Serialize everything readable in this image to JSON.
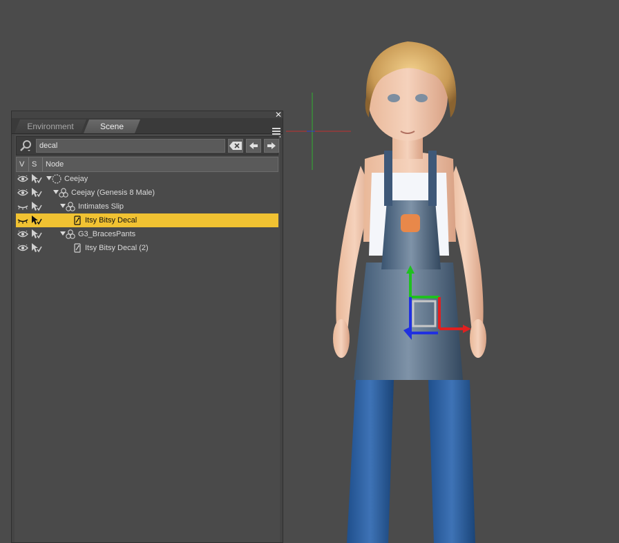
{
  "pane": {
    "tabs": [
      {
        "label": "Environment",
        "active": false
      },
      {
        "label": "Scene",
        "active": true
      }
    ]
  },
  "search": {
    "value": "decal",
    "placeholder": ""
  },
  "tree": {
    "columns": [
      "V",
      "S",
      "Node"
    ],
    "rows": [
      {
        "label": "Ceejay",
        "icon": "group-node-icon",
        "depth": 0,
        "expandable": true,
        "selected": false,
        "visible": true
      },
      {
        "label": "Ceejay (Genesis 8 Male)",
        "icon": "figure-icon",
        "depth": 1,
        "expandable": true,
        "selected": false,
        "visible": true
      },
      {
        "label": "Intimates Slip",
        "icon": "figure-icon",
        "depth": 2,
        "expandable": true,
        "selected": false,
        "visible": false
      },
      {
        "label": "Itsy Bitsy Decal",
        "icon": "decal-icon",
        "depth": 3,
        "expandable": false,
        "selected": true,
        "visible": false
      },
      {
        "label": "G3_BracesPants",
        "icon": "figure-icon",
        "depth": 2,
        "expandable": true,
        "selected": false,
        "visible": true
      },
      {
        "label": "Itsy Bitsy Decal (2)",
        "icon": "decal-icon",
        "depth": 3,
        "expandable": false,
        "selected": false,
        "visible": true
      }
    ]
  },
  "colors": {
    "viewport_bg": "#4b4b4b",
    "selection": "#f1c232",
    "axis_x": "#e02020",
    "axis_y": "#20c020",
    "axis_z": "#2030e0"
  }
}
